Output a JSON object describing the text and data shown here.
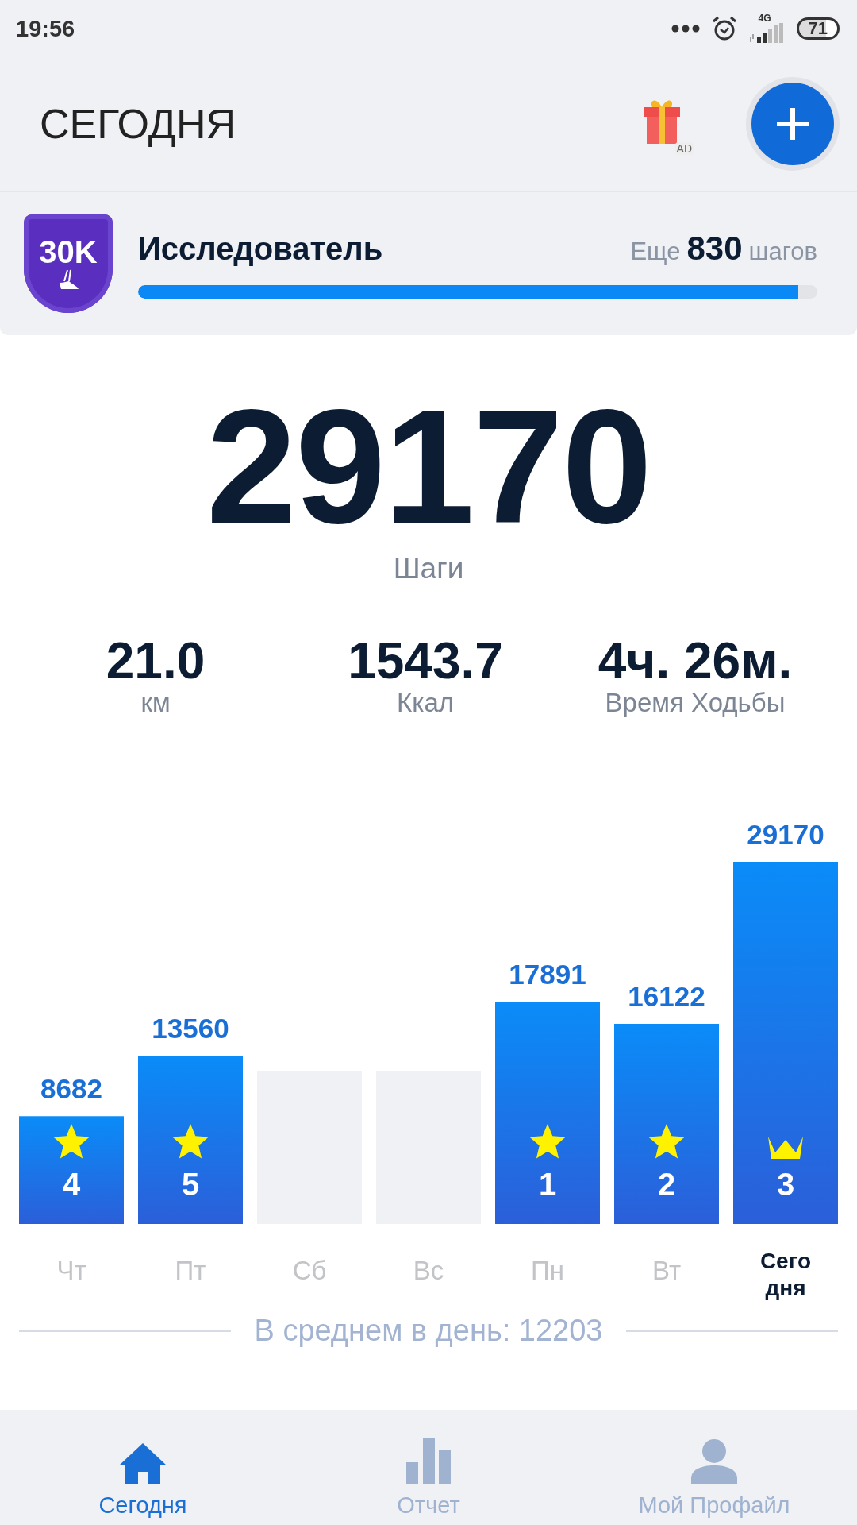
{
  "status_bar": {
    "time": "19:56",
    "network": "4G",
    "battery": "71"
  },
  "header": {
    "title": "СЕГОДНЯ",
    "gift_tag": "AD"
  },
  "achievement": {
    "badge": "30K",
    "title": "Исследователь",
    "remaining_prefix": "Еще",
    "remaining_value": "830",
    "remaining_suffix": "шагов",
    "level": 0.972
  },
  "steps": {
    "value": "29170",
    "label": "Шаги"
  },
  "stats": [
    {
      "value": "21.0",
      "label": "км"
    },
    {
      "value": "1543.7",
      "label": "Ккал"
    },
    {
      "value": "4ч. 26м.",
      "label": "Время Ходьбы"
    }
  ],
  "week": {
    "chart_data": {
      "type": "bar",
      "categories": [
        "Чт",
        "Пт",
        "Сб",
        "Вс",
        "Пн",
        "Вт",
        "Сегодня"
      ],
      "values": [
        8682,
        13560,
        null,
        null,
        17891,
        16122,
        29170
      ],
      "data_labels": true
    },
    "marks": [
      {
        "kind": "star",
        "rank": "4",
        "selected": false
      },
      {
        "kind": "star",
        "rank": "5",
        "selected": false
      },
      {
        "kind": "none",
        "selected": false
      },
      {
        "kind": "none",
        "selected": false
      },
      {
        "kind": "star",
        "rank": "1",
        "selected": false
      },
      {
        "kind": "star",
        "rank": "2",
        "selected": false
      },
      {
        "kind": "crown",
        "rank": "3",
        "selected": true
      }
    ],
    "average": "В среднем в день: 12203"
  },
  "nav": [
    {
      "kind": "home",
      "label": "Сегодня",
      "selected": true
    },
    {
      "kind": "report",
      "label": "Отчет",
      "selected": false
    },
    {
      "kind": "profile",
      "label": "Мой Профайл",
      "selected": false
    }
  ]
}
